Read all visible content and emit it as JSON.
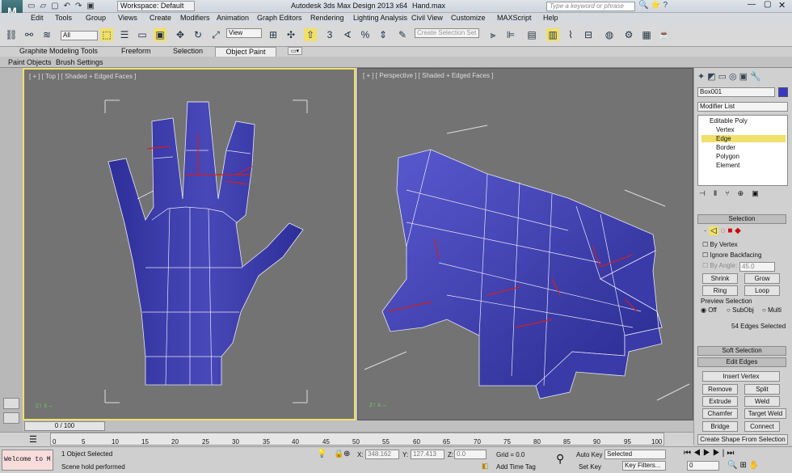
{
  "title": {
    "workspace": "Workspace: Default",
    "app": "Autodesk 3ds Max Design 2013 x64",
    "file": "Hand.max",
    "search_placeholder": "Type a keyword or phrase"
  },
  "menu": [
    "Edit",
    "Tools",
    "Group",
    "Views",
    "Create",
    "Modifiers",
    "Animation",
    "Graph Editors",
    "Rendering",
    "Lighting Analysis",
    "Civil View",
    "Customize",
    "MAXScript",
    "Help"
  ],
  "toolbar": {
    "filter": "All",
    "refcoord": "View",
    "snap": "3",
    "selset_placeholder": "Create Selection Set"
  },
  "ribbon_tabs": [
    "Graphite Modeling Tools",
    "Freeform",
    "Selection",
    "Object Paint"
  ],
  "sub_tabs": [
    "Paint Objects",
    "Brush Settings"
  ],
  "viewports": {
    "top": "[ + ] [ Top ] [ Shaded + Edged Faces ]",
    "persp": "[ + ] [ Perspective ] [ Shaded + Edged Faces ]"
  },
  "cmd": {
    "object_name": "Box001",
    "modifier_list": "Modifier List",
    "stack": [
      "Editable Poly",
      "Vertex",
      "Edge",
      "Border",
      "Polygon",
      "Element"
    ],
    "selection_header": "Selection",
    "by_vertex": "By Vertex",
    "ignore_backfacing": "Ignore Backfacing",
    "by_angle": "By Angle:",
    "angle_value": "45.0",
    "shrink": "Shrink",
    "grow": "Grow",
    "ring": "Ring",
    "loop": "Loop",
    "preview_selection": "Preview Selection",
    "preview_opts": [
      "Off",
      "SubObj",
      "Multi"
    ],
    "selected_count": "54 Edges Selected",
    "soft_selection": "Soft Selection",
    "edit_edges": "Edit Edges",
    "insert_vertex": "Insert Vertex",
    "remove": "Remove",
    "split": "Split",
    "extrude": "Extrude",
    "weld": "Weld",
    "chamfer": "Chamfer",
    "target_weld": "Target Weld",
    "bridge": "Bridge",
    "connect": "Connect",
    "create_shape": "Create Shape From Selection"
  },
  "timeline": {
    "frame": "0 / 100",
    "ticks": [
      "0",
      "5",
      "10",
      "15",
      "20",
      "25",
      "30",
      "35",
      "40",
      "45",
      "50",
      "55",
      "60",
      "65",
      "70",
      "75",
      "80",
      "85",
      "90",
      "95",
      "100"
    ]
  },
  "status": {
    "maxscript": "Welcome to M",
    "selected": "1 Object Selected",
    "prompt": "Scene hold performed",
    "x_label": "X:",
    "x_value": "348.162",
    "y_label": "Y:",
    "y_value": "127.413",
    "z_label": "Z:",
    "z_value": "0.0",
    "grid": "Grid = 0.0",
    "add_time_tag": "Add Time Tag",
    "auto_key": "Auto Key",
    "key_mode": "Selected",
    "set_key": "Set Key",
    "key_filters": "Key Filters...",
    "frame_value": "0"
  },
  "colors": {
    "accent": "#f0e06a",
    "mesh": "#3a3aa8",
    "viewport_bg": "#737373"
  }
}
